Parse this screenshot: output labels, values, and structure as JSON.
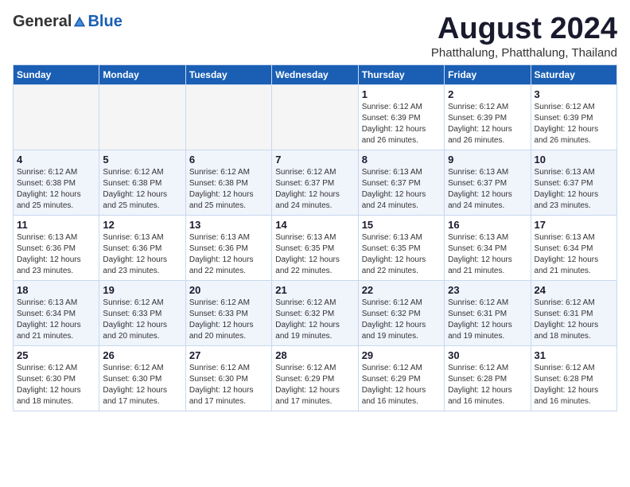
{
  "header": {
    "logo_general": "General",
    "logo_blue": "Blue",
    "month_year": "August 2024",
    "location": "Phatthalung, Phatthalung, Thailand"
  },
  "weekdays": [
    "Sunday",
    "Monday",
    "Tuesday",
    "Wednesday",
    "Thursday",
    "Friday",
    "Saturday"
  ],
  "weeks": [
    [
      {
        "day": "",
        "info": ""
      },
      {
        "day": "",
        "info": ""
      },
      {
        "day": "",
        "info": ""
      },
      {
        "day": "",
        "info": ""
      },
      {
        "day": "1",
        "info": "Sunrise: 6:12 AM\nSunset: 6:39 PM\nDaylight: 12 hours\nand 26 minutes."
      },
      {
        "day": "2",
        "info": "Sunrise: 6:12 AM\nSunset: 6:39 PM\nDaylight: 12 hours\nand 26 minutes."
      },
      {
        "day": "3",
        "info": "Sunrise: 6:12 AM\nSunset: 6:39 PM\nDaylight: 12 hours\nand 26 minutes."
      }
    ],
    [
      {
        "day": "4",
        "info": "Sunrise: 6:12 AM\nSunset: 6:38 PM\nDaylight: 12 hours\nand 25 minutes."
      },
      {
        "day": "5",
        "info": "Sunrise: 6:12 AM\nSunset: 6:38 PM\nDaylight: 12 hours\nand 25 minutes."
      },
      {
        "day": "6",
        "info": "Sunrise: 6:12 AM\nSunset: 6:38 PM\nDaylight: 12 hours\nand 25 minutes."
      },
      {
        "day": "7",
        "info": "Sunrise: 6:12 AM\nSunset: 6:37 PM\nDaylight: 12 hours\nand 24 minutes."
      },
      {
        "day": "8",
        "info": "Sunrise: 6:13 AM\nSunset: 6:37 PM\nDaylight: 12 hours\nand 24 minutes."
      },
      {
        "day": "9",
        "info": "Sunrise: 6:13 AM\nSunset: 6:37 PM\nDaylight: 12 hours\nand 24 minutes."
      },
      {
        "day": "10",
        "info": "Sunrise: 6:13 AM\nSunset: 6:37 PM\nDaylight: 12 hours\nand 23 minutes."
      }
    ],
    [
      {
        "day": "11",
        "info": "Sunrise: 6:13 AM\nSunset: 6:36 PM\nDaylight: 12 hours\nand 23 minutes."
      },
      {
        "day": "12",
        "info": "Sunrise: 6:13 AM\nSunset: 6:36 PM\nDaylight: 12 hours\nand 23 minutes."
      },
      {
        "day": "13",
        "info": "Sunrise: 6:13 AM\nSunset: 6:36 PM\nDaylight: 12 hours\nand 22 minutes."
      },
      {
        "day": "14",
        "info": "Sunrise: 6:13 AM\nSunset: 6:35 PM\nDaylight: 12 hours\nand 22 minutes."
      },
      {
        "day": "15",
        "info": "Sunrise: 6:13 AM\nSunset: 6:35 PM\nDaylight: 12 hours\nand 22 minutes."
      },
      {
        "day": "16",
        "info": "Sunrise: 6:13 AM\nSunset: 6:34 PM\nDaylight: 12 hours\nand 21 minutes."
      },
      {
        "day": "17",
        "info": "Sunrise: 6:13 AM\nSunset: 6:34 PM\nDaylight: 12 hours\nand 21 minutes."
      }
    ],
    [
      {
        "day": "18",
        "info": "Sunrise: 6:13 AM\nSunset: 6:34 PM\nDaylight: 12 hours\nand 21 minutes."
      },
      {
        "day": "19",
        "info": "Sunrise: 6:12 AM\nSunset: 6:33 PM\nDaylight: 12 hours\nand 20 minutes."
      },
      {
        "day": "20",
        "info": "Sunrise: 6:12 AM\nSunset: 6:33 PM\nDaylight: 12 hours\nand 20 minutes."
      },
      {
        "day": "21",
        "info": "Sunrise: 6:12 AM\nSunset: 6:32 PM\nDaylight: 12 hours\nand 19 minutes."
      },
      {
        "day": "22",
        "info": "Sunrise: 6:12 AM\nSunset: 6:32 PM\nDaylight: 12 hours\nand 19 minutes."
      },
      {
        "day": "23",
        "info": "Sunrise: 6:12 AM\nSunset: 6:31 PM\nDaylight: 12 hours\nand 19 minutes."
      },
      {
        "day": "24",
        "info": "Sunrise: 6:12 AM\nSunset: 6:31 PM\nDaylight: 12 hours\nand 18 minutes."
      }
    ],
    [
      {
        "day": "25",
        "info": "Sunrise: 6:12 AM\nSunset: 6:30 PM\nDaylight: 12 hours\nand 18 minutes."
      },
      {
        "day": "26",
        "info": "Sunrise: 6:12 AM\nSunset: 6:30 PM\nDaylight: 12 hours\nand 17 minutes."
      },
      {
        "day": "27",
        "info": "Sunrise: 6:12 AM\nSunset: 6:30 PM\nDaylight: 12 hours\nand 17 minutes."
      },
      {
        "day": "28",
        "info": "Sunrise: 6:12 AM\nSunset: 6:29 PM\nDaylight: 12 hours\nand 17 minutes."
      },
      {
        "day": "29",
        "info": "Sunrise: 6:12 AM\nSunset: 6:29 PM\nDaylight: 12 hours\nand 16 minutes."
      },
      {
        "day": "30",
        "info": "Sunrise: 6:12 AM\nSunset: 6:28 PM\nDaylight: 12 hours\nand 16 minutes."
      },
      {
        "day": "31",
        "info": "Sunrise: 6:12 AM\nSunset: 6:28 PM\nDaylight: 12 hours\nand 16 minutes."
      }
    ]
  ]
}
